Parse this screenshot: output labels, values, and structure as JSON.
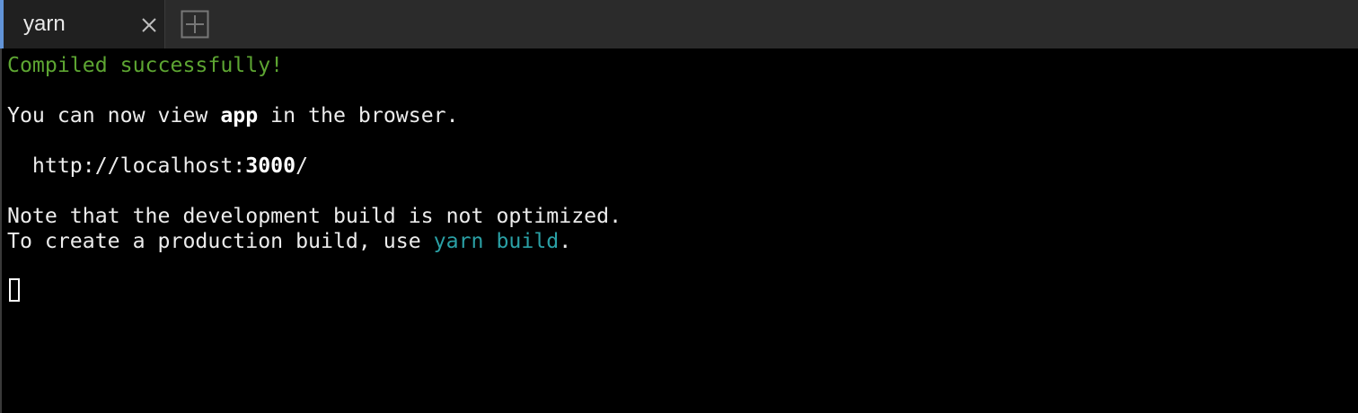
{
  "tabs": [
    {
      "label": "yarn",
      "active": true
    }
  ],
  "colors": {
    "tab_accent": "#6294d8",
    "success_green": "#5da532",
    "command_cyan": "#2aa0a5",
    "text": "#ececec",
    "background": "#000000"
  },
  "terminal": {
    "line1": "Compiled successfully!",
    "line2_pre": "You can now view ",
    "line2_bold": "app",
    "line2_post": " in the browser.",
    "line3_pre": "  http://localhost:",
    "line3_bold": "3000",
    "line3_post": "/",
    "line4": "Note that the development build is not optimized.",
    "line5_pre": "To create a production build, use ",
    "line5_cmd": "yarn build",
    "line5_post": "."
  }
}
